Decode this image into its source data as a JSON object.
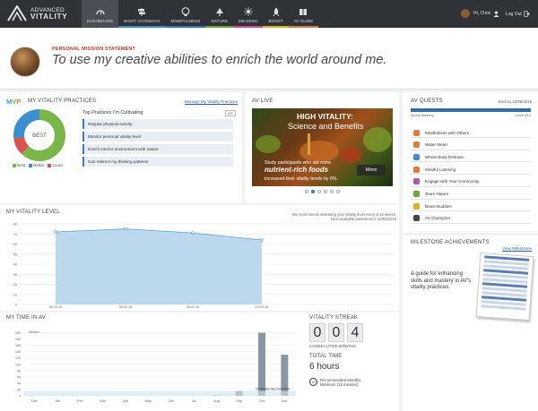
{
  "app": {
    "logo_line1": "ADVANCED",
    "logo_line2": "VITALITY"
  },
  "nav": [
    {
      "label": "DASHBOARD",
      "icon": "gauge-icon",
      "accent": "#4a4e55",
      "active": true
    },
    {
      "label": "EIGHT GATEWAYS",
      "icon": "signpost-icon",
      "accent": "#3a8fd0"
    },
    {
      "label": "MINDFULNESS",
      "icon": "head-icon",
      "accent": "#2c78c0"
    },
    {
      "label": "NATURE",
      "icon": "tree-icon",
      "accent": "#6aa83a"
    },
    {
      "label": "MEANING",
      "icon": "sun-icon",
      "accent": "#d54a8a"
    },
    {
      "label": "BOOST",
      "icon": "rocket-icon",
      "accent": "#e0b020"
    },
    {
      "label": "AV GUIDE",
      "icon": "book-icon",
      "accent": "#e07a3a"
    }
  ],
  "user": {
    "greeting": "Hi, Chris",
    "logout": "Log Out"
  },
  "mission": {
    "label": "PERSONAL MISSION STATEMENT",
    "text": "To use my creative abilities to enrich the world around me."
  },
  "practices": {
    "mvp_m": "M",
    "mvp_v": "V",
    "mvp_p": "P",
    "title": "MY VITALITY PRACTICES",
    "manage_link": "Manage My Vitality Practices",
    "donut_center": "BEST",
    "donut_fractions": {
      "best": 0.62,
      "better": 0.27,
      "good": 0.11
    },
    "legend": [
      {
        "label": "Best",
        "color": "#7ab648"
      },
      {
        "label": "Better",
        "color": "#3a8fd0"
      },
      {
        "label": "Good",
        "color": "#d9534f"
      }
    ],
    "top_title": "Top Practices I'm Cultivating",
    "top_badge": "4/5",
    "top_items": [
      "Regular physical activity",
      "Monitor personal vitality level",
      "Enrich interior environment with nature",
      "Can redirect my thinking patterns"
    ]
  },
  "live": {
    "title": "AV LIVE",
    "headline1": "HIGH VITALITY:",
    "headline2": "Science and Benefits",
    "text1": "Study participants who ate more",
    "text2": "nutrient-rich foods",
    "text3": "increased their vitality levels by 8%.",
    "more": "More"
  },
  "quests": {
    "title": "AV QUESTS",
    "ends": "End on 12/09/2015",
    "bar_left": "Quest Mastery",
    "bar_right": "Level #12",
    "items": [
      {
        "label": "Mindfulness with Others",
        "color": "#e07a3a"
      },
      {
        "label": "Water Meter",
        "color": "#e07a3a"
      },
      {
        "label": "Whole Body Release",
        "color": "#3a8fd0"
      },
      {
        "label": "Mindful Listening",
        "color": "#e07a3a"
      },
      {
        "label": "Engage with Your Community",
        "color": "#b056b0"
      },
      {
        "label": "Team Nature",
        "color": "#6aa83a"
      },
      {
        "label": "Boost Buddies",
        "color": "#e0b020"
      },
      {
        "label": "AV Champion",
        "color": "#444444"
      }
    ]
  },
  "milestone": {
    "title": "MILESTONE ACHIEVEMENTS",
    "link": "View Milestones",
    "text": "A guide for enhancing skills and mastery in AV's vitality practices."
  },
  "vitality_level": {
    "title": "MY VITALITY LEVEL",
    "note1": "We recommend assessing your vitality level every 8-12 weeks.",
    "note2": "Next available assessment: 10/02/2015"
  },
  "my_time": {
    "title": "MY TIME IN AV",
    "streak_label": "VITALITY STREAK",
    "digits": [
      "0",
      "0",
      "4"
    ],
    "consecutive": "CONSECUTIVE MONTHS",
    "total_label": "TOTAL TIME",
    "total_value": "6 hours",
    "rec1": "Recommended Monthly",
    "rec2": "Minimum (15 minutes)",
    "clock": "15"
  },
  "chart_data": [
    {
      "type": "area",
      "title": "MY VITALITY LEVEL",
      "x": [
        "06-03-15",
        "06-02-15",
        "08-02-15",
        "10-02-15"
      ],
      "series": [
        {
          "values": [
            72,
            75,
            71,
            64
          ]
        }
      ],
      "yticks": [
        0,
        10,
        20,
        30,
        40,
        50,
        60,
        70,
        80
      ],
      "ylim": [
        0,
        80
      ],
      "xticks": [
        "06-02-15",
        "08-01-15",
        "10-02-15"
      ]
    },
    {
      "type": "bar",
      "title": "MY TIME IN AV",
      "ylabel": "Minutes",
      "categories": [
        "Dec",
        "Jan",
        "Feb",
        "Mar",
        "Apr",
        "May",
        "Jun",
        "Jul",
        "Aug",
        "Sep",
        "Oct",
        "Nov"
      ],
      "series": [
        {
          "values": [
            0,
            0,
            0,
            0,
            0,
            0,
            0,
            0,
            2,
            15,
            200,
            130
          ]
        }
      ],
      "ylim": [
        0,
        210
      ],
      "yticks": [
        0,
        20,
        40,
        60,
        80,
        100,
        120,
        140,
        160,
        180,
        200
      ],
      "reference_value": 15,
      "reference_label": "15 Minutes Recommended"
    }
  ]
}
